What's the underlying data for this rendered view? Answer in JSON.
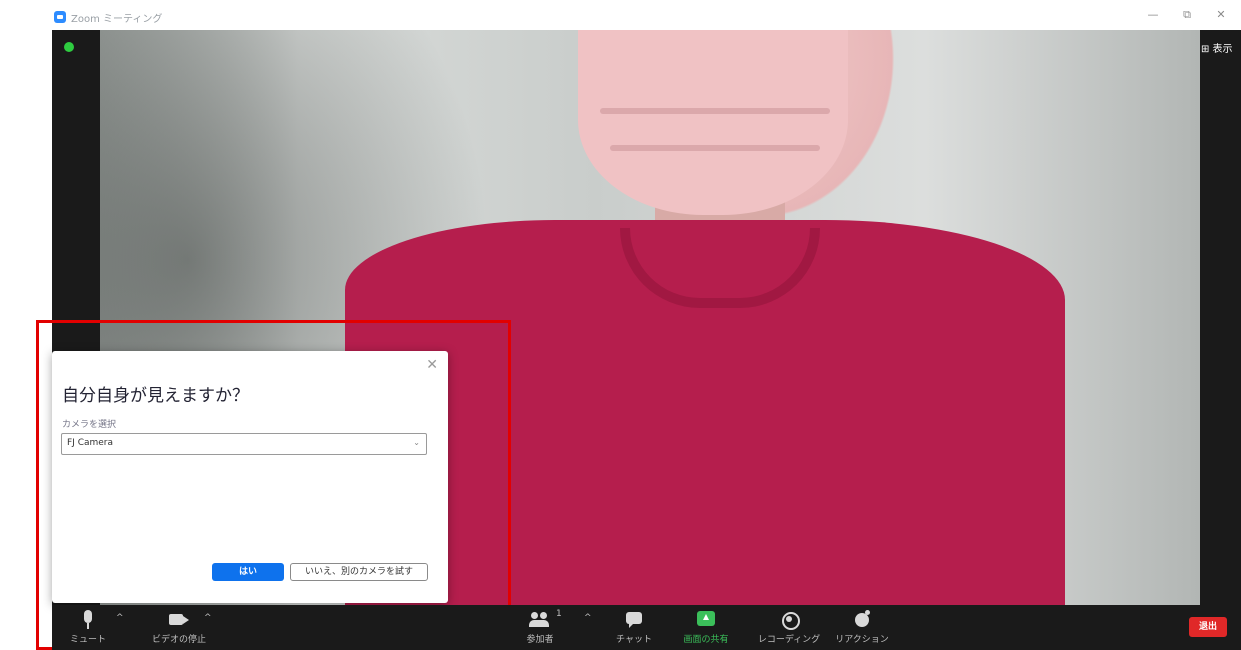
{
  "window": {
    "title": "Zoom ミーティング",
    "minimize": "—",
    "restore": "⧉",
    "close": "✕"
  },
  "meeting": {
    "view_label": "⊞ 表示"
  },
  "dialog": {
    "close": "✕",
    "title": "自分自身が見えますか？",
    "camera_label": "カメラを選択",
    "camera_value": "FJ Camera",
    "caret": "⌄",
    "yes_label": "はい",
    "try_other_label": "いいえ、別のカメラを試す"
  },
  "toolbar": {
    "caret": "^",
    "mute_label": "ミュート",
    "stop_video_label": "ビデオの停止",
    "participants_count": "1",
    "participants_label": "参加者",
    "chat_label": "チャット",
    "share_label": "画面の共有",
    "record_label": "レコーディング",
    "reactions_label": "リアクション",
    "leave_label": "退出"
  },
  "colors": {
    "accent": "#0e72ed",
    "share_green": "#3bbf5a",
    "leave_red": "#e02828",
    "highlight_red": "#e20000"
  }
}
